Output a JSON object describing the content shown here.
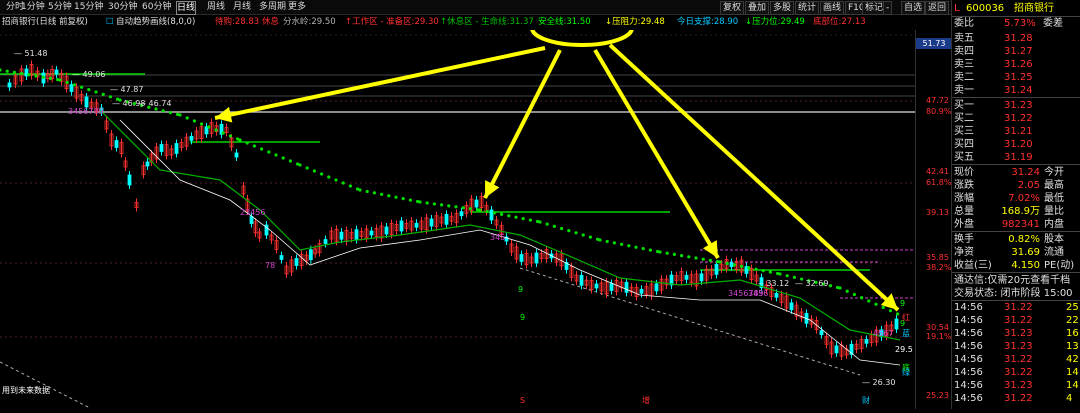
{
  "toolbar": {
    "periods": [
      "分时",
      "1分钟",
      "5分钟",
      "15分钟",
      "30分钟",
      "60分钟",
      "日线",
      "周线",
      "月线",
      "多周期",
      "更多"
    ],
    "active_period": "日线",
    "tools": [
      "复权",
      "叠加",
      "多股",
      "统计",
      "画线",
      "F10",
      "标记",
      "-",
      "自选",
      "返回"
    ]
  },
  "infobar": {
    "stock_line": "招商银行(日线 前复权)",
    "indicator": "自动趋势画线(8,0,0)",
    "items": [
      {
        "label": "待购:",
        "value": "28.83",
        "color": "#ff3030"
      },
      {
        "label": "休息",
        "value": "",
        "color": "#ff3030"
      },
      {
        "label": "分水岭:",
        "value": "29.50",
        "color": "#b0b0b0"
      },
      {
        "label": "↑工作区 - 准备区:",
        "value": "29.30",
        "color": "#ff3030"
      },
      {
        "label": "↑休息区 - 生命线:",
        "value": "31.37",
        "color": "#00c000"
      },
      {
        "label": "安全线:",
        "value": "31.50",
        "color": "#00ff00"
      },
      {
        "label": "↓压阻力:",
        "value": "29.48",
        "color": "#ffff00"
      },
      {
        "label": "今日支撑:",
        "value": "28.90",
        "color": "#00c8ff"
      },
      {
        "label": "↓压力位:",
        "value": "29.49",
        "color": "#00ff00"
      },
      {
        "label": "底部位:",
        "value": "27.13",
        "color": "#ff3030"
      }
    ],
    "down_arrow": "↓"
  },
  "chart": {
    "price_labels": [
      {
        "text": "51.48",
        "color": "#e0e0e0"
      },
      {
        "text": "49.06",
        "color": "#e0e0e0"
      },
      {
        "text": "47.87",
        "color": "#e0e0e0"
      },
      {
        "text": "46.98",
        "color": "#e0e0e0"
      },
      {
        "text": "46.74",
        "color": "#e0e0e0"
      },
      {
        "text": "33.12",
        "color": "#e0e0e0"
      },
      {
        "text": "32.69",
        "color": "#e0e0e0"
      },
      {
        "text": "26.30",
        "color": "#e0e0e0"
      }
    ],
    "seq_labels": [
      "3456789",
      "23456",
      "78",
      "345",
      "9",
      "3456",
      "9",
      "3456789",
      "4567",
      "9",
      "9"
    ],
    "right_labels": [
      "红",
      "蓝",
      "29.5",
      "底",
      "绿"
    ],
    "bottom_marks": [
      "S",
      "增",
      "财"
    ],
    "future_note": "用到未来数据"
  },
  "y_axis": {
    "values": [
      "51.73",
      "47.72",
      "42.41",
      "39.13",
      "35.85",
      "30.54",
      "25.23"
    ],
    "pct_values": [
      "80.9%",
      "61.8%",
      "38.2%",
      "19.1%"
    ],
    "pct_color": "#ff3030",
    "value_color": "#ff3030",
    "current_value": "51.73"
  },
  "quote": {
    "code": "600036",
    "name": "招商银行",
    "flag": "L",
    "wb_label": "委比",
    "wb_value": "5.73%",
    "wc_label": "委差",
    "asks": [
      {
        "label": "卖五",
        "price": "31.28"
      },
      {
        "label": "卖四",
        "price": "31.27"
      },
      {
        "label": "卖三",
        "price": "31.26"
      },
      {
        "label": "卖二",
        "price": "31.25"
      },
      {
        "label": "卖一",
        "price": "31.24"
      }
    ],
    "bids": [
      {
        "label": "买一",
        "price": "31.23"
      },
      {
        "label": "买二",
        "price": "31.22"
      },
      {
        "label": "买三",
        "price": "31.21"
      },
      {
        "label": "买四",
        "price": "31.20"
      },
      {
        "label": "买五",
        "price": "31.19"
      }
    ],
    "stats": [
      {
        "l1": "现价",
        "v1": "31.24",
        "l2": "今开"
      },
      {
        "l1": "涨跌",
        "v1": "2.05",
        "l2": "最高"
      },
      {
        "l1": "涨幅",
        "v1": "7.02%",
        "l2": "最低"
      },
      {
        "l1": "总量",
        "v1": "168.9万",
        "l2": "量比"
      },
      {
        "l1": "外盘",
        "v1": "982341",
        "l2": "内盘"
      }
    ],
    "stats2": [
      {
        "l1": "换手",
        "v1": "0.82%",
        "l2": "股本"
      },
      {
        "l1": "净资",
        "v1": "31.69",
        "l2": "流通"
      },
      {
        "l1": "收益(三)",
        "v1": "4.150",
        "l2": "PE(动)"
      }
    ],
    "notice": "通达信:仅需20元查看千档",
    "trade_state": "交易状态: 闭市阶段 15:00",
    "ticks": [
      {
        "time": "14:56",
        "price": "31.22",
        "vol": "25"
      },
      {
        "time": "14:56",
        "price": "31.22",
        "vol": "22"
      },
      {
        "time": "14:56",
        "price": "31.23",
        "vol": "16"
      },
      {
        "time": "14:56",
        "price": "31.23",
        "vol": "13"
      },
      {
        "time": "14:56",
        "price": "31.22",
        "vol": "42"
      },
      {
        "time": "14:56",
        "price": "31.22",
        "vol": "14"
      },
      {
        "time": "14:56",
        "price": "31.23",
        "vol": "14"
      },
      {
        "time": "14:56",
        "price": "31.22",
        "vol": "4"
      }
    ],
    "colors": {
      "up": "#ff3030",
      "down": "#00ff00",
      "label": "#e0e0e0",
      "name": "#ffff00",
      "price": "#ff3030"
    }
  }
}
